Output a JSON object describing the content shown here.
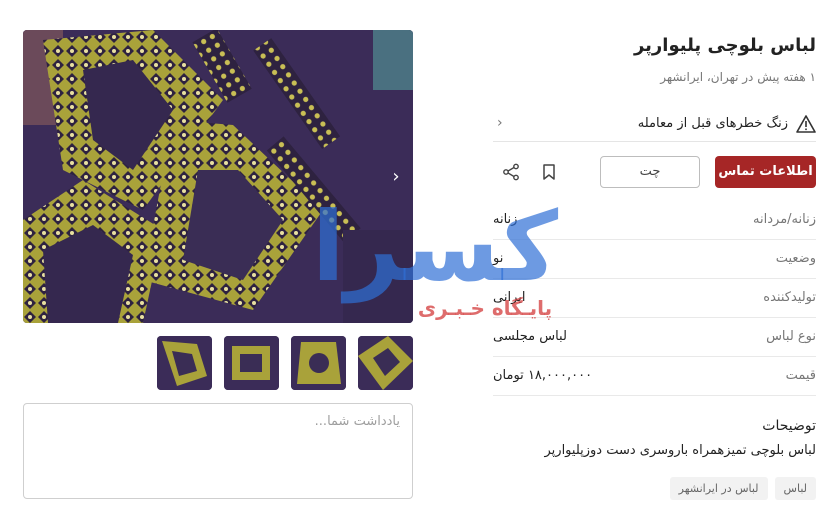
{
  "listing": {
    "title": "لباس بلوچی پلیوارپر",
    "subtitle": "۱ هفته پیش در تهران، ایرانشهر"
  },
  "warning": {
    "text": "زنگ خطرهای قبل از معامله",
    "icon": "warning-triangle-icon"
  },
  "actions": {
    "contact_label": "اطلاعات تماس",
    "chat_label": "چت",
    "bookmark_icon": "bookmark-icon",
    "share_icon": "share-icon"
  },
  "attributes": [
    {
      "key": "زنانه/مردانه",
      "value": "زنانه"
    },
    {
      "key": "وضعیت",
      "value": "نو"
    },
    {
      "key": "تولیدکننده",
      "value": "ایرانی"
    },
    {
      "key": "نوع لباس",
      "value": "لباس مجلسی"
    },
    {
      "key": "قیمت",
      "value": "۱۸,۰۰۰,۰۰۰ تومان"
    }
  ],
  "description": {
    "title": "توضیحات",
    "text": "لباس بلوچی تمیزهمراه باروسری دست دوزپلیوارپر"
  },
  "tags": [
    "لباس",
    "لباس در ایرانشهر"
  ],
  "note": {
    "placeholder": "یادداشت شما..."
  },
  "watermark": {
    "main": "کسرا",
    "sub": "پایـگاه خـبـری"
  },
  "colors": {
    "accent": "#a62626",
    "fabric": "#3a2a55",
    "embroidery": "#b8b040",
    "watermark_blue": "#2f6fd6",
    "watermark_red": "#d33b3b"
  }
}
